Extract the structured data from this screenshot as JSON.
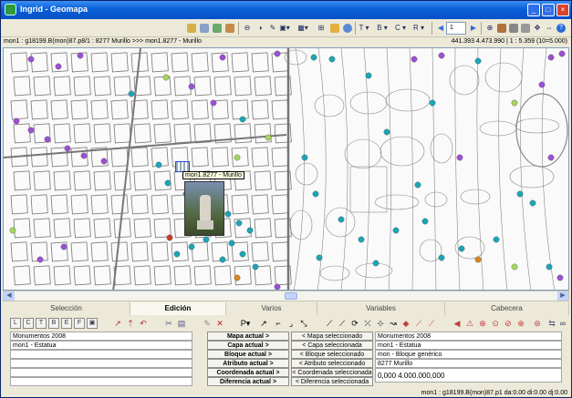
{
  "window": {
    "title": "Ingrid - Geomapa",
    "buttons": [
      "_",
      "□",
      "×"
    ]
  },
  "toolbar": {
    "menu_t": "T ▾",
    "menu_b": "B ▾",
    "menu_c": "C ▾",
    "menu_r": "R ▾",
    "page_value": "1"
  },
  "statusline": {
    "path": "mon1 : g18199.B(mon)87.p8/1 : 8277 Murillo  >>>  mon1.8277 - Murillo",
    "coords": "441.393  4.473.990  |  1 : 5.359 (10=5.000)"
  },
  "map": {
    "tooltip": "mon1.8277 - Murillo",
    "colors": {
      "violet": "#9b4fd6",
      "cyan": "#1aa6b7",
      "lime": "#a4d65e",
      "orange": "#d9861c",
      "red": "#cc3a2a"
    }
  },
  "tabs": [
    "Selección",
    "Edición",
    "Varios",
    "Variables",
    "Cabecera"
  ],
  "active_tab": "Edición",
  "panel": {
    "left_rows": [
      "Monumentos 2008",
      "mon1 - Estatua",
      "",
      "",
      "",
      ""
    ],
    "center_buttons": [
      "Mapa actual >",
      "Capa actual >",
      "Bloque actual >",
      "Atributo actual >",
      "Coordenada actual >",
      "Diferencia actual >"
    ],
    "center_buttons2": [
      "< Mapa seleccionado",
      "< Capa seleccionada",
      "< Bloque seleccionado",
      "< Atributo seleccionado",
      "< Coordenada seleccionada",
      "< Diferencia seleccionada"
    ],
    "right_rows": [
      "Monumentos 2008",
      "mon1 - Estatua",
      "mon - Bloque genérico",
      "8277 Murillo",
      "0,000  4.000.000,000",
      ""
    ]
  },
  "footer": {
    "text": "mon1 : g18199.B(mon)87.p1  da:0.00  di:0.00  dj:0.00"
  },
  "icons": {
    "toolbar": [
      "zoom-icon",
      "print-icon",
      "layers-icon",
      "export-icon",
      "circle-icon",
      "contrast-icon",
      "pen-icon",
      "dropdown-icon",
      "grid-icon",
      "ruler-icon",
      "folder-icon",
      "globe-icon",
      "hand-icon",
      "help-icon"
    ],
    "edit_row": [
      "node-icon",
      "select-icon",
      "undo-icon",
      "delete-icon",
      "line-icon",
      "curve-icon",
      "cut-icon",
      "join-icon",
      "arrow-icon",
      "flag-icon",
      "paint-icon",
      "binoculars-icon"
    ]
  }
}
